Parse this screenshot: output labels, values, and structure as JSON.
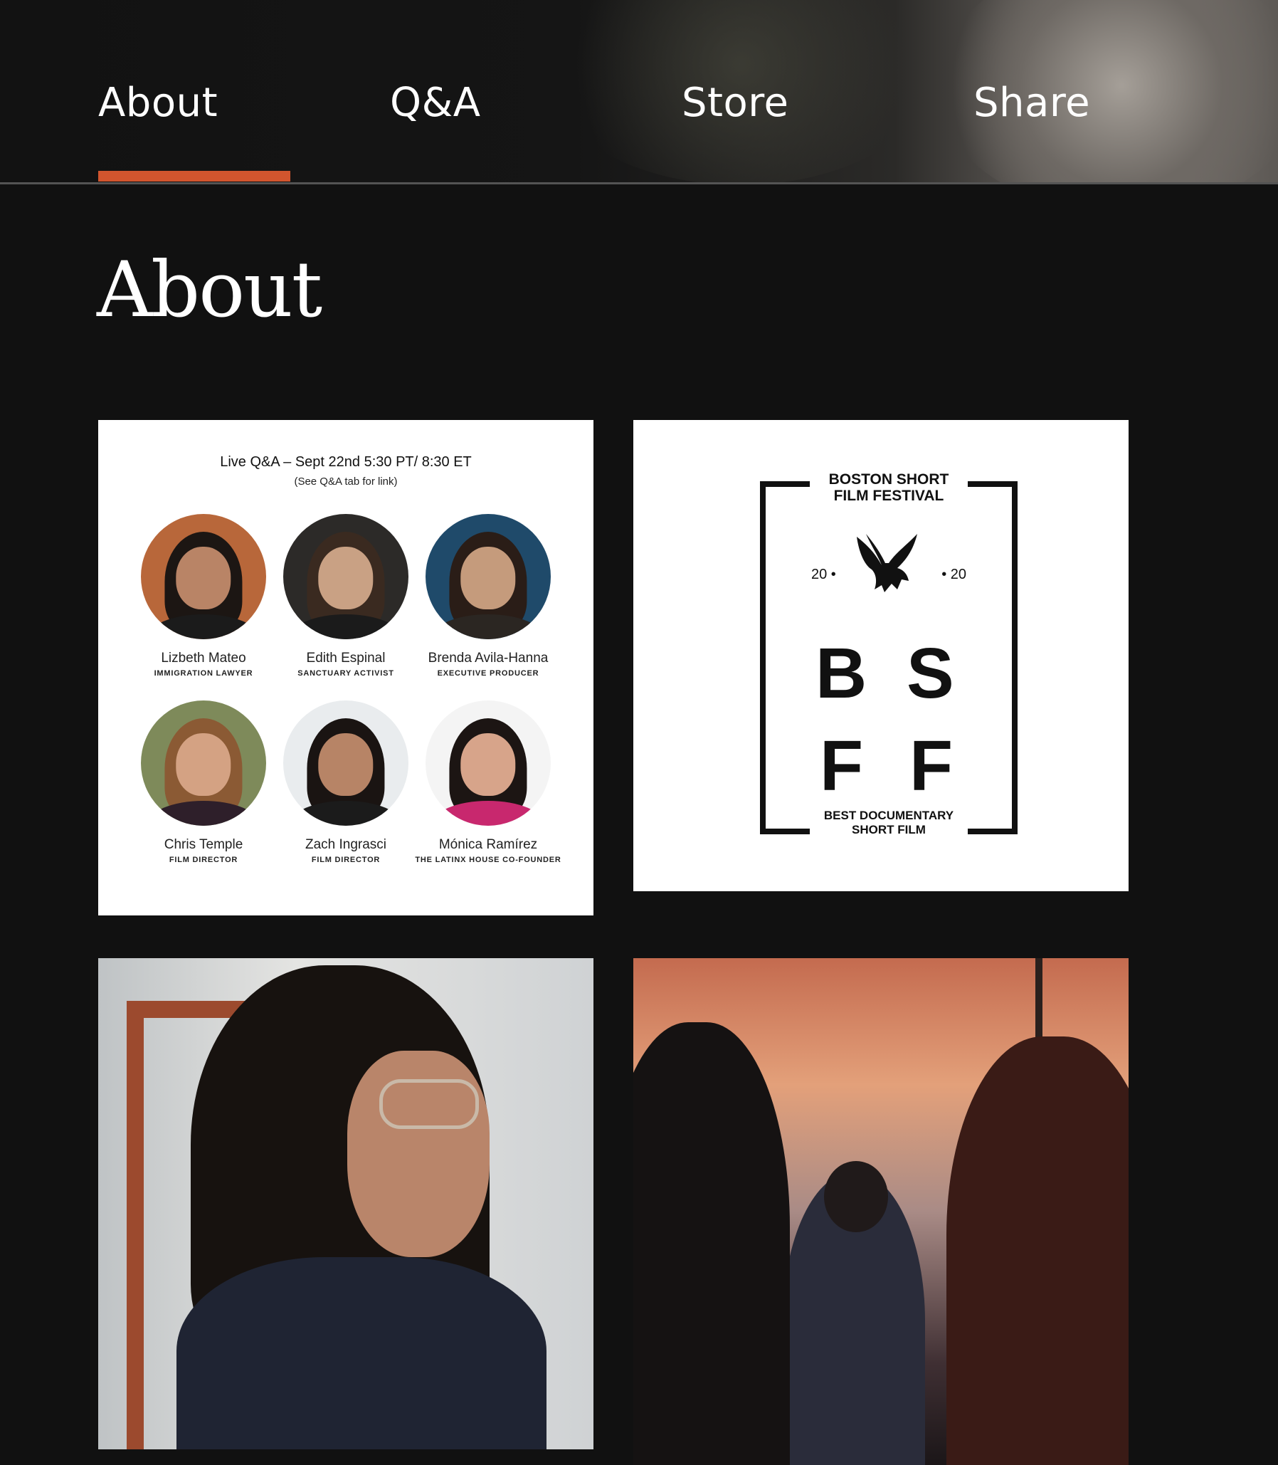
{
  "nav": {
    "tabs": [
      {
        "label": "About",
        "active": true
      },
      {
        "label": "Q&A",
        "active": false
      },
      {
        "label": "Store",
        "active": false
      },
      {
        "label": "Share",
        "active": false
      }
    ],
    "active_color": "#d2552e"
  },
  "page": {
    "title": "About"
  },
  "qa_card": {
    "title": "Live Q&A – Sept 22nd 5:30 PT/ 8:30 ET",
    "subtitle": "(See Q&A tab for link)",
    "people": [
      {
        "name": "Lizbeth Mateo",
        "role": "IMMIGRATION LAWYER"
      },
      {
        "name": "Edith Espinal",
        "role": "SANCTUARY ACTIVIST"
      },
      {
        "name": "Brenda Avila-Hanna",
        "role": "EXECUTIVE PRODUCER"
      },
      {
        "name": "Chris Temple",
        "role": "FILM DIRECTOR"
      },
      {
        "name": "Zach Ingrasci",
        "role": "FILM DIRECTOR"
      },
      {
        "name": "Mónica Ramírez",
        "role": "THE LATINX HOUSE CO-FOUNDER"
      }
    ]
  },
  "award": {
    "top_line1": "BOSTON SHORT",
    "top_line2": "FILM FESTIVAL",
    "year_left": "20 •",
    "year_right": "• 20",
    "letters": [
      "B",
      "S",
      "F",
      "F"
    ],
    "bottom_line1": "BEST DOCUMENTARY",
    "bottom_line2": "SHORT FILM"
  }
}
